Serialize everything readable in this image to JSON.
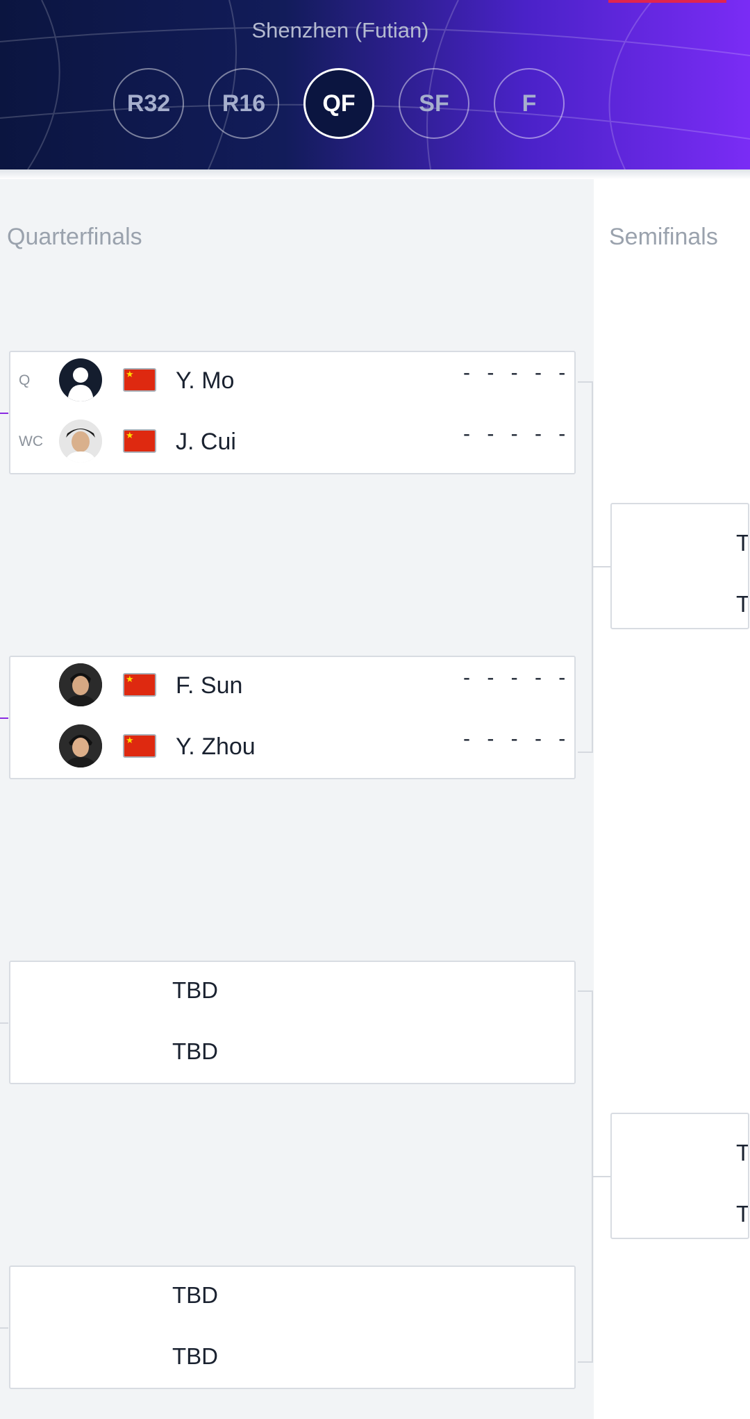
{
  "header": {
    "location": "Shenzhen (Futian)",
    "rounds": [
      {
        "label": "R32",
        "active": false
      },
      {
        "label": "R16",
        "active": false
      },
      {
        "label": "QF",
        "active": true
      },
      {
        "label": "SF",
        "active": false
      },
      {
        "label": "F",
        "active": false
      }
    ]
  },
  "columns": {
    "quarterfinals": "Quarterfinals",
    "semifinals": "Semifinals"
  },
  "matches": [
    {
      "players": [
        {
          "seed": "Q",
          "name": "Y. Mo",
          "score": "- - - - -"
        },
        {
          "seed": "WC",
          "name": "J. Cui",
          "score": "- - - - -"
        }
      ]
    },
    {
      "players": [
        {
          "seed": "",
          "name": "F. Sun",
          "score": "- - - - -"
        },
        {
          "seed": "",
          "name": "Y. Zhou",
          "score": "- - - - -"
        }
      ]
    },
    {
      "players": [
        {
          "name": "TBD"
        },
        {
          "name": "TBD"
        }
      ]
    },
    {
      "players": [
        {
          "name": "TBD"
        },
        {
          "name": "TBD"
        }
      ]
    }
  ],
  "semifinals": [
    {
      "players": [
        {
          "name": "T"
        },
        {
          "name": "T"
        }
      ]
    },
    {
      "players": [
        {
          "name": "T"
        },
        {
          "name": "T"
        }
      ]
    }
  ],
  "colors": {
    "header_start": "#0b1540",
    "header_end": "#7a2cf5",
    "accent_red": "#e0254f",
    "connector_purple": "#8a2be2"
  }
}
